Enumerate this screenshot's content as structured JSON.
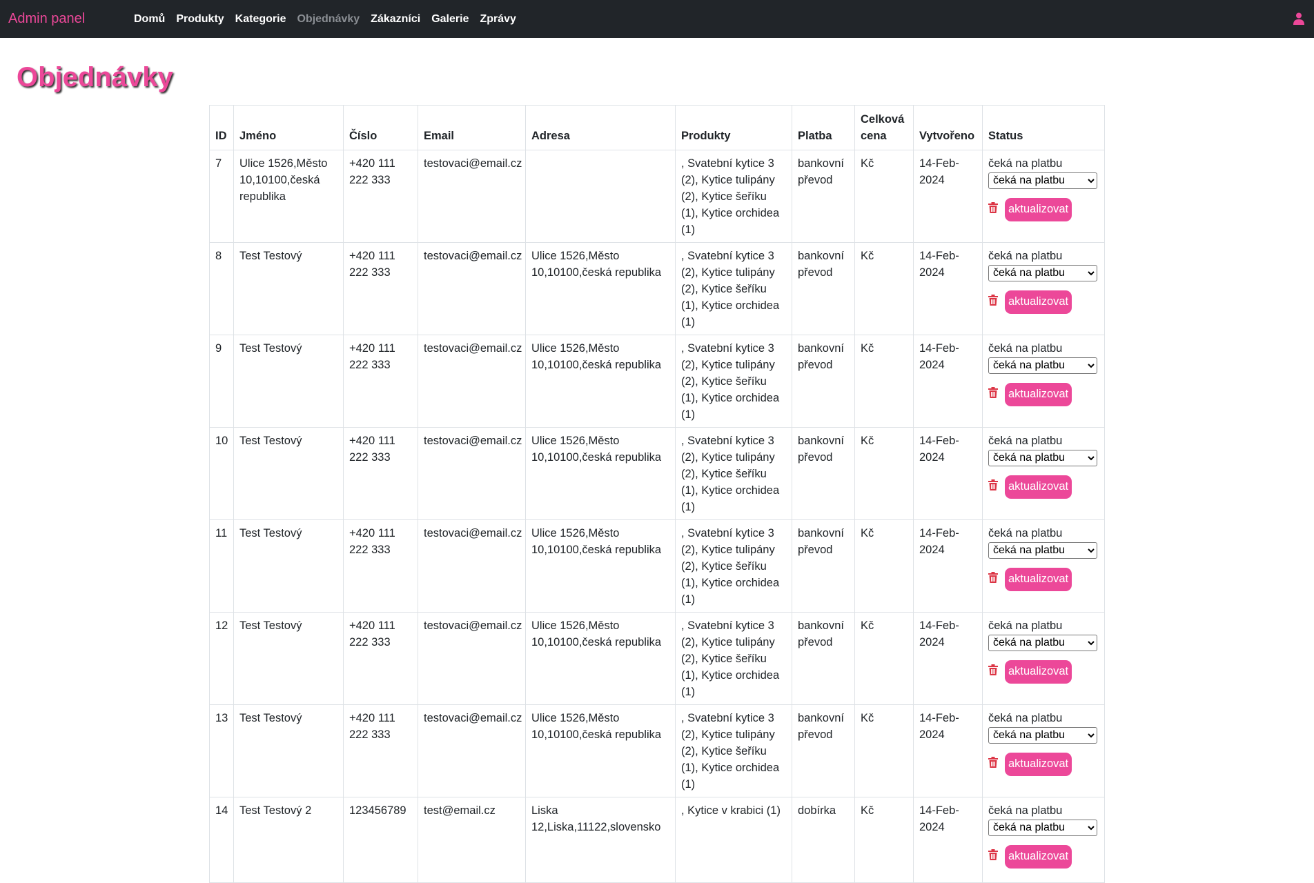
{
  "nav": {
    "brand": "Admin panel",
    "links": [
      "Domů",
      "Produkty",
      "Kategorie",
      "Objednávky",
      "Zákazníci",
      "Galerie",
      "Zprávy"
    ],
    "active_index": 3
  },
  "colors": {
    "accent": "#ec4899",
    "navbar_bg": "#212529",
    "danger": "#dc3545"
  },
  "page": {
    "title": "Objednávky"
  },
  "table": {
    "headers": [
      "ID",
      "Jméno",
      "Číslo",
      "Email",
      "Adresa",
      "Produkty",
      "Platba",
      "Celková cena",
      "Vytvořeno",
      "Status"
    ],
    "rows": [
      {
        "id": "7",
        "name": "Ulice 1526,Město 10,10100,česká republika",
        "phone": "+420 111 222 333",
        "email": "testovaci@email.cz",
        "address": "",
        "products": ", Svatební kytice 3 (2), Kytice tulipány (2), Kytice šeříku (1), Kytice orchidea (1)",
        "payment": "bankovní převod",
        "total": "Kč",
        "created": "14-Feb-2024",
        "status": "čeká na platbu",
        "select_value": "čeká na platbu",
        "button": "aktualizovat"
      },
      {
        "id": "8",
        "name": "Test Testový",
        "phone": "+420 111 222 333",
        "email": "testovaci@email.cz",
        "address": "Ulice 1526,Město 10,10100,česká republika",
        "products": ", Svatební kytice 3 (2), Kytice tulipány (2), Kytice šeříku (1), Kytice orchidea (1)",
        "payment": "bankovní převod",
        "total": "Kč",
        "created": "14-Feb-2024",
        "status": "čeká na platbu",
        "select_value": "čeká na platbu",
        "button": "aktualizovat"
      },
      {
        "id": "9",
        "name": "Test Testový",
        "phone": "+420 111 222 333",
        "email": "testovaci@email.cz",
        "address": "Ulice 1526,Město 10,10100,česká republika",
        "products": ", Svatební kytice 3 (2), Kytice tulipány (2), Kytice šeříku (1), Kytice orchidea (1)",
        "payment": "bankovní převod",
        "total": "Kč",
        "created": "14-Feb-2024",
        "status": "čeká na platbu",
        "select_value": "čeká na platbu",
        "button": "aktualizovat"
      },
      {
        "id": "10",
        "name": "Test Testový",
        "phone": "+420 111 222 333",
        "email": "testovaci@email.cz",
        "address": "Ulice 1526,Město 10,10100,česká republika",
        "products": ", Svatební kytice 3 (2), Kytice tulipány (2), Kytice šeříku (1), Kytice orchidea (1)",
        "payment": "bankovní převod",
        "total": "Kč",
        "created": "14-Feb-2024",
        "status": "čeká na platbu",
        "select_value": "čeká na platbu",
        "button": "aktualizovat"
      },
      {
        "id": "11",
        "name": "Test Testový",
        "phone": "+420 111 222 333",
        "email": "testovaci@email.cz",
        "address": "Ulice 1526,Město 10,10100,česká republika",
        "products": ", Svatební kytice 3 (2), Kytice tulipány (2), Kytice šeříku (1), Kytice orchidea (1)",
        "payment": "bankovní převod",
        "total": "Kč",
        "created": "14-Feb-2024",
        "status": "čeká na platbu",
        "select_value": "čeká na platbu",
        "button": "aktualizovat"
      },
      {
        "id": "12",
        "name": "Test Testový",
        "phone": "+420 111 222 333",
        "email": "testovaci@email.cz",
        "address": "Ulice 1526,Město 10,10100,česká republika",
        "products": ", Svatební kytice 3 (2), Kytice tulipány (2), Kytice šeříku (1), Kytice orchidea (1)",
        "payment": "bankovní převod",
        "total": "Kč",
        "created": "14-Feb-2024",
        "status": "čeká na platbu",
        "select_value": "čeká na platbu",
        "button": "aktualizovat"
      },
      {
        "id": "13",
        "name": "Test Testový",
        "phone": "+420 111 222 333",
        "email": "testovaci@email.cz",
        "address": "Ulice 1526,Město 10,10100,česká republika",
        "products": ", Svatební kytice 3 (2), Kytice tulipány (2), Kytice šeříku (1), Kytice orchidea (1)",
        "payment": "bankovní převod",
        "total": "Kč",
        "created": "14-Feb-2024",
        "status": "čeká na platbu",
        "select_value": "čeká na platbu",
        "button": "aktualizovat"
      },
      {
        "id": "14",
        "name": "Test Testový 2",
        "phone": "123456789",
        "email": "test@email.cz",
        "address": "Liska 12,Liska,11122,slovensko",
        "products": ", Kytice v krabici (1)",
        "payment": "dobírka",
        "total": "Kč",
        "created": "14-Feb-2024",
        "status": "čeká na platbu",
        "select_value": "čeká na platbu",
        "button": "aktualizovat"
      }
    ]
  }
}
